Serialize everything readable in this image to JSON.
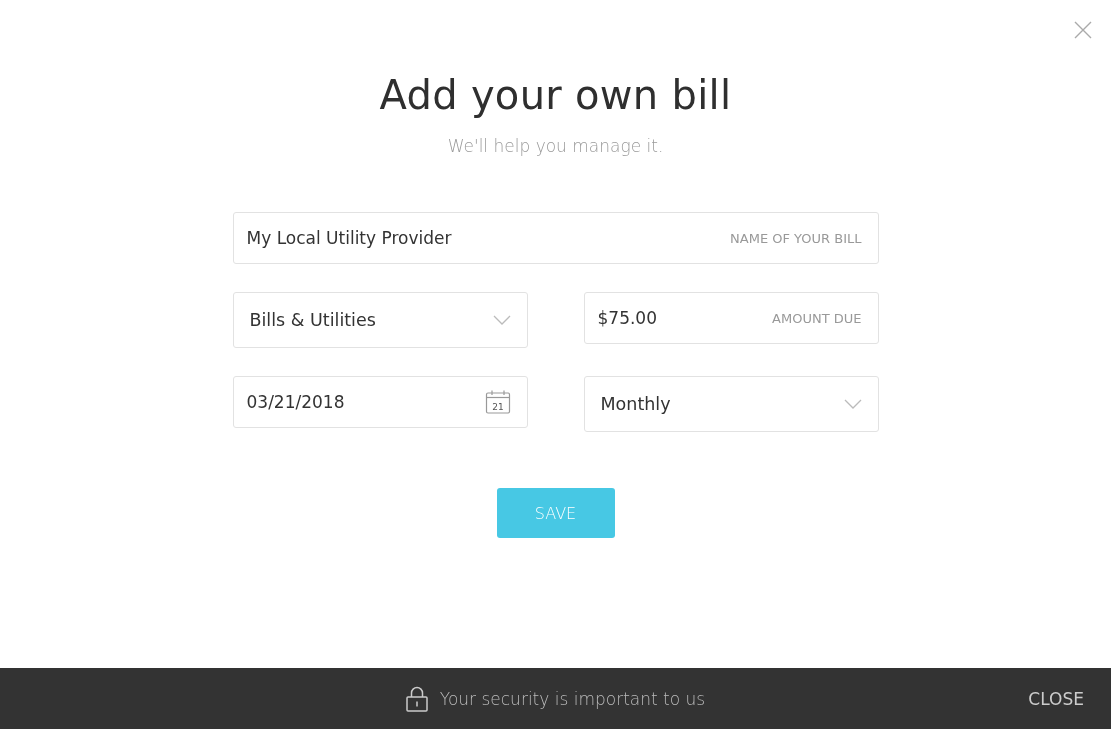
{
  "title": "Add your own bill",
  "subtitle": "We'll help you manage it.",
  "fields": [
    {
      "kind": "text",
      "value": "My Local Utility Provider",
      "label": "NAME OF YOUR BILL"
    },
    {
      "kind": "select",
      "value": "Bills & Utilities"
    },
    {
      "kind": "text",
      "value": "$75.00",
      "label": "AMOUNT DUE"
    },
    {
      "kind": "date",
      "value": "03/21/2018",
      "calendar_day": "21"
    },
    {
      "kind": "select",
      "value": "Monthly"
    }
  ],
  "save_button": "SAVE",
  "footer": {
    "security_note": "Your security is important to us",
    "close": "CLOSE"
  }
}
